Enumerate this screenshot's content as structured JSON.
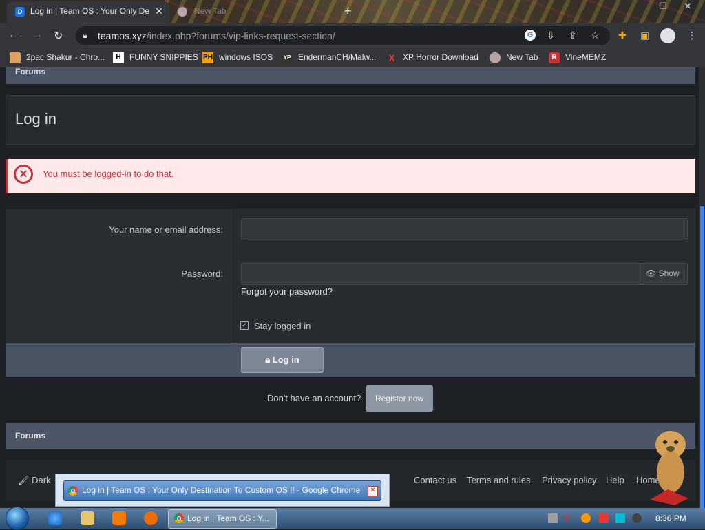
{
  "browser": {
    "active_tab_title": "Log in | Team OS : Your Only Destination",
    "inactive_tab_title": "New Tab",
    "url_domain": "teamos.xyz",
    "url_path": "/index.php?forums/vip-links-request-section/"
  },
  "bookmarks": [
    {
      "label": "2pac Shakur - Chro...",
      "icon": "image-icon"
    },
    {
      "label": "FUNNY SNIPPIES",
      "icon": "H"
    },
    {
      "label": "windows ISOS",
      "icon": "PH"
    },
    {
      "label": "EndermanCH/Malw...",
      "icon": "YP"
    },
    {
      "label": "XP Horror Download",
      "icon": "X"
    },
    {
      "label": "New Tab",
      "icon": "globe-icon"
    },
    {
      "label": "VineMEMZ",
      "icon": "R"
    }
  ],
  "page": {
    "breadcrumb_top": "Forums",
    "title": "Log in",
    "error": "You must be logged-in to do that.",
    "form": {
      "name_label": "Your name or email address:",
      "password_label": "Password:",
      "show_label": "Show",
      "forgot_link": "Forgot your password?",
      "stay_logged_in": "Stay logged in",
      "login_button": "Log in"
    },
    "register_prompt": "Don't have an account?",
    "register_button": "Register now",
    "breadcrumb_bottom": "Forums",
    "footer": {
      "style_chooser": "Dark",
      "links": [
        "Contact us",
        "Terms and rules",
        "Privacy policy",
        "Help",
        "Home"
      ]
    }
  },
  "popup": {
    "title": "Log in | Team OS : Your Only Destination To Custom OS !! - Google Chrome"
  },
  "taskbar": {
    "task_label": "Log in | Team OS : Y...",
    "clock": "8:36 PM"
  },
  "colors": {
    "error_red": "#c8323b",
    "error_bg": "#fde8ea",
    "page_bg": "#1d2024",
    "breadcrumb_bg": "#4b5566",
    "scroll_accent": "#3b82f6"
  }
}
